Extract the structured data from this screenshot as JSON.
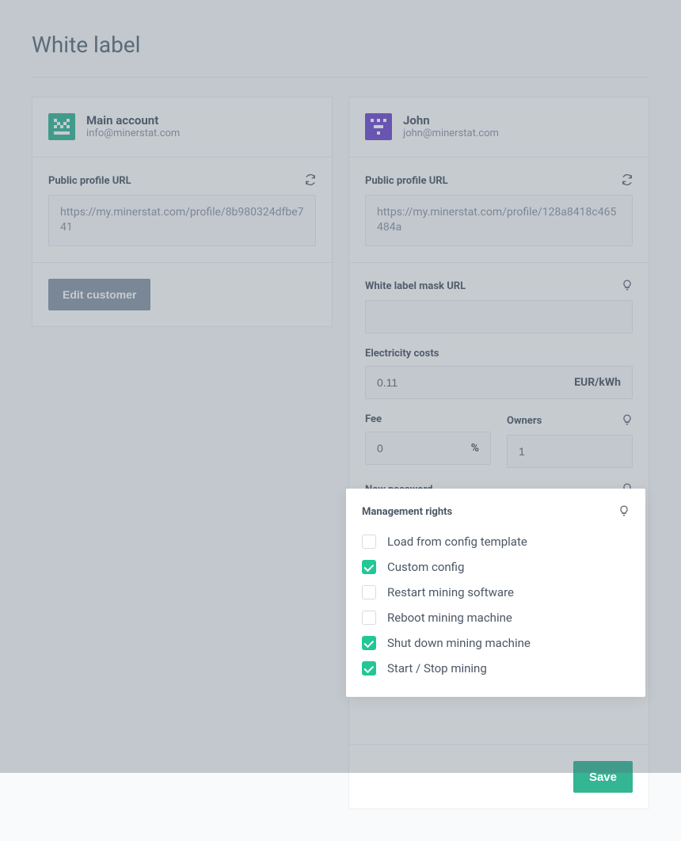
{
  "page_title": "White label",
  "left": {
    "name": "Main account",
    "email": "info@minerstat.com",
    "public_url_label": "Public profile URL",
    "public_url": "https://my.minerstat.com/profile/8b980324dfbe741",
    "edit_button": "Edit customer"
  },
  "right": {
    "name": "John",
    "email": "john@minerstat.com",
    "public_url_label": "Public profile URL",
    "public_url": "https://my.minerstat.com/profile/128a8418c465484a",
    "mask_url_label": "White label mask URL",
    "mask_url": "",
    "electricity_label": "Electricity costs",
    "electricity_value": "0.11",
    "electricity_unit": "EUR/kWh",
    "fee_label": "Fee",
    "fee_value": "0",
    "fee_unit": "%",
    "owners_label": "Owners",
    "owners_value": "1",
    "new_password_label": "New password",
    "new_password_value": "",
    "save_button": "Save"
  },
  "rights": {
    "title": "Management rights",
    "items": [
      {
        "label": "Load from config template",
        "checked": false
      },
      {
        "label": "Custom config",
        "checked": true
      },
      {
        "label": "Restart mining software",
        "checked": false
      },
      {
        "label": "Reboot mining machine",
        "checked": false
      },
      {
        "label": "Shut down mining machine",
        "checked": true
      },
      {
        "label": "Start / Stop mining",
        "checked": true
      }
    ]
  }
}
